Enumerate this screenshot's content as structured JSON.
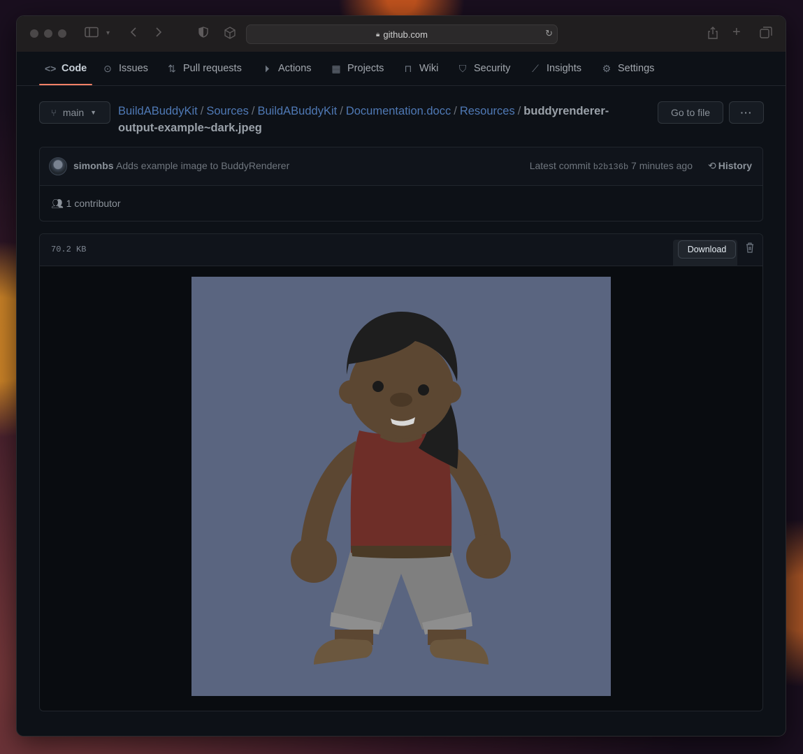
{
  "browser": {
    "url": "github.com"
  },
  "repo_nav": {
    "tabs": [
      {
        "label": "Code",
        "icon": "code-icon",
        "active": true
      },
      {
        "label": "Issues",
        "icon": "issue-icon"
      },
      {
        "label": "Pull requests",
        "icon": "pull-request-icon"
      },
      {
        "label": "Actions",
        "icon": "play-icon"
      },
      {
        "label": "Projects",
        "icon": "table-icon"
      },
      {
        "label": "Wiki",
        "icon": "book-icon"
      },
      {
        "label": "Security",
        "icon": "shield-icon"
      },
      {
        "label": "Insights",
        "icon": "graph-icon"
      },
      {
        "label": "Settings",
        "icon": "gear-icon"
      }
    ]
  },
  "file_nav": {
    "branch": "main",
    "breadcrumb": [
      "BuildABuddyKit",
      "Sources",
      "BuildABuddyKit",
      "Documentation.docc",
      "Resources"
    ],
    "separator": "/",
    "filename": "buddyrenderer-output-example~dark.jpeg",
    "go_to_file": "Go to file",
    "more": "···"
  },
  "commit": {
    "author": "simonbs",
    "message": "Adds example image to BuddyRenderer",
    "latest_label": "Latest commit",
    "sha": "b2b136b",
    "time": "7 minutes ago",
    "history": "History",
    "contributors": "1 contributor"
  },
  "file": {
    "size": "70.2 KB",
    "download": "Download"
  },
  "colors": {
    "accent_underline": "#f78166",
    "link": "#4f79b5",
    "image_background": "#5a6580"
  }
}
